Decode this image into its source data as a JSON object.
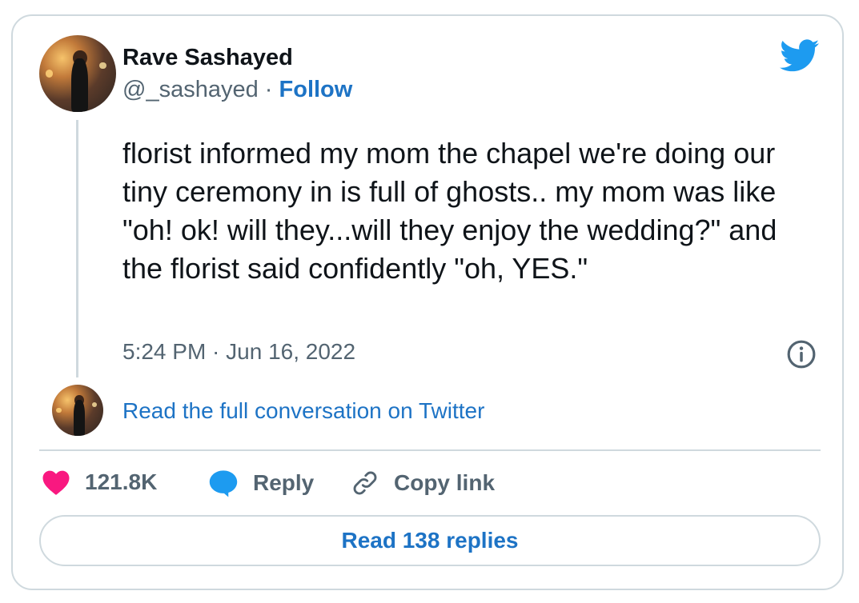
{
  "author": {
    "name": "Rave Sashayed",
    "handle": "@_sashayed",
    "separator": "·",
    "follow_label": "Follow"
  },
  "tweet": {
    "text": "florist informed my mom the chapel we're doing our tiny ceremony in is full of ghosts.. my mom was like \"oh! ok! will they...will they enjoy the wedding?\" and the florist said confidently \"oh, YES.\"",
    "timestamp": "5:24 PM · Jun 16, 2022"
  },
  "conversation_link": "Read the full conversation on Twitter",
  "actions": {
    "like_count": "121.8K",
    "reply_label": "Reply",
    "copy_label": "Copy link"
  },
  "replies_button": "Read 138 replies",
  "colors": {
    "accent": "#1d73c5",
    "twitter_blue": "#1d9bf0",
    "like": "#f91880",
    "muted": "#536471",
    "border": "#cfd9de"
  },
  "icons": [
    "twitter-bird-icon",
    "info-icon",
    "heart-icon",
    "reply-bubble-icon",
    "link-icon"
  ]
}
